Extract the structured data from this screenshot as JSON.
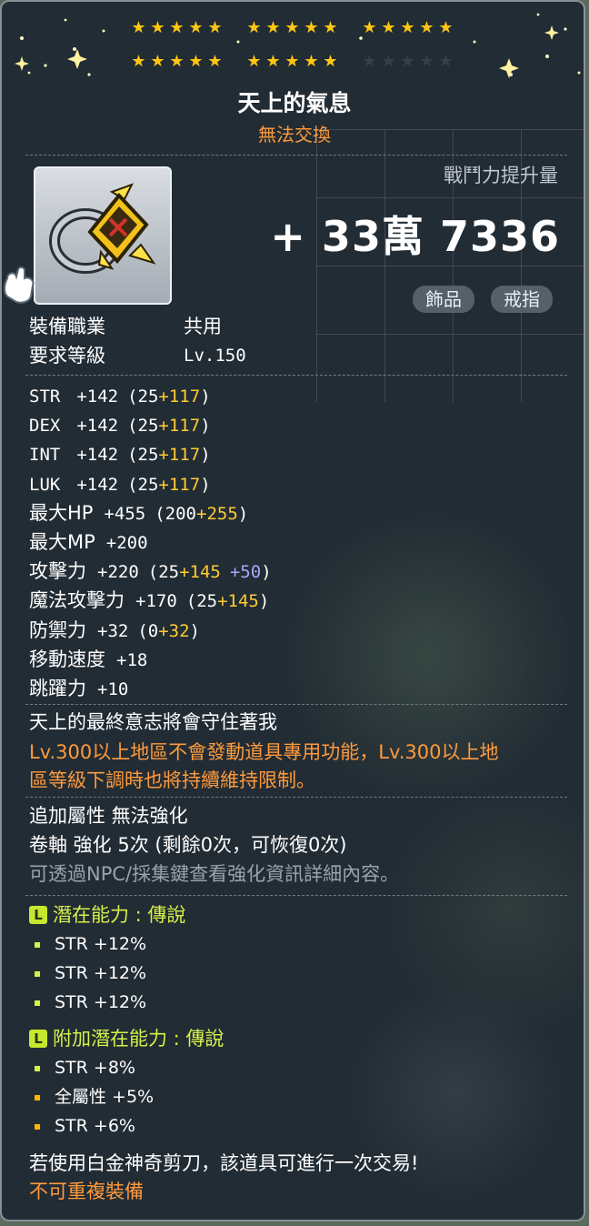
{
  "header": {
    "star_rows": [
      {
        "groups": [
          5,
          5,
          5
        ],
        "filled": 15
      },
      {
        "groups": [
          5,
          5,
          5
        ],
        "filled": 10
      }
    ],
    "item_name": "天上的氣息",
    "trade_status": "無法交換"
  },
  "power": {
    "label": "戰鬥力提升量",
    "value": "+ 33萬 7336"
  },
  "tags": [
    "飾品",
    "戒指"
  ],
  "requirements": [
    {
      "label": "裝備職業",
      "value": "共用"
    },
    {
      "label": "要求等級",
      "value": "Lv.150"
    }
  ],
  "stats": [
    {
      "name": "STR",
      "total": "+142",
      "base": "(25",
      "bonus": "+117",
      "extra": "",
      "close": ")"
    },
    {
      "name": "DEX",
      "total": "+142",
      "base": "(25",
      "bonus": "+117",
      "extra": "",
      "close": ")"
    },
    {
      "name": "INT",
      "total": "+142",
      "base": "(25",
      "bonus": "+117",
      "extra": "",
      "close": ")"
    },
    {
      "name": "LUK",
      "total": "+142",
      "base": "(25",
      "bonus": "+117",
      "extra": "",
      "close": ")"
    },
    {
      "name": "最大HP",
      "total": "+455",
      "base": "(200",
      "bonus": "+255",
      "extra": "",
      "close": ")"
    },
    {
      "name": "最大MP",
      "total": "+200",
      "base": "",
      "bonus": "",
      "extra": "",
      "close": ""
    },
    {
      "name": "攻擊力",
      "total": "+220",
      "base": "(25",
      "bonus": "+145",
      "extra": "+50",
      "close": ")"
    },
    {
      "name": "魔法攻擊力",
      "total": "+170",
      "base": "(25",
      "bonus": "+145",
      "extra": "",
      "close": ")"
    },
    {
      "name": "防禦力",
      "total": "+32",
      "base": "(0",
      "bonus": "+32",
      "extra": "",
      "close": ")"
    },
    {
      "name": "移動速度",
      "total": "+18",
      "base": "",
      "bonus": "",
      "extra": "",
      "close": ""
    },
    {
      "name": "跳躍力",
      "total": "+10",
      "base": "",
      "bonus": "",
      "extra": "",
      "close": ""
    }
  ],
  "description": {
    "flavor": "天上的最終意志將會守住著我",
    "notice_line1": "Lv.300以上地區不會發動道具專用功能，Lv.300以上地",
    "notice_line2": "區等級下調時也將持續維持限制。"
  },
  "enhance": {
    "line1": "追加屬性 無法強化",
    "line2": "卷軸 強化 5次 (剩餘0次，可恢復0次)",
    "line3": "可透過NPC/採集鍵查看強化資訊詳細內容。"
  },
  "potential": {
    "badge": "L",
    "title": "潛在能力 : 傳說",
    "lines": [
      "STR +12%",
      "STR +12%",
      "STR +12%"
    ]
  },
  "bonus_potential": {
    "badge": "L",
    "title": "附加潛在能力 : 傳說",
    "lines": [
      "STR +8%",
      "全屬性 +5%",
      "STR +6%"
    ]
  },
  "footer": {
    "trade_hint": "若使用白金神奇剪刀，該道具可進行一次交易!",
    "no_duplicate": "不可重複裝備"
  },
  "colors": {
    "gold": "#ffcc33",
    "orange": "#ff9a3d",
    "lime": "#d6f04a",
    "blue": "#a7a7ff",
    "star": "#ffc514"
  }
}
